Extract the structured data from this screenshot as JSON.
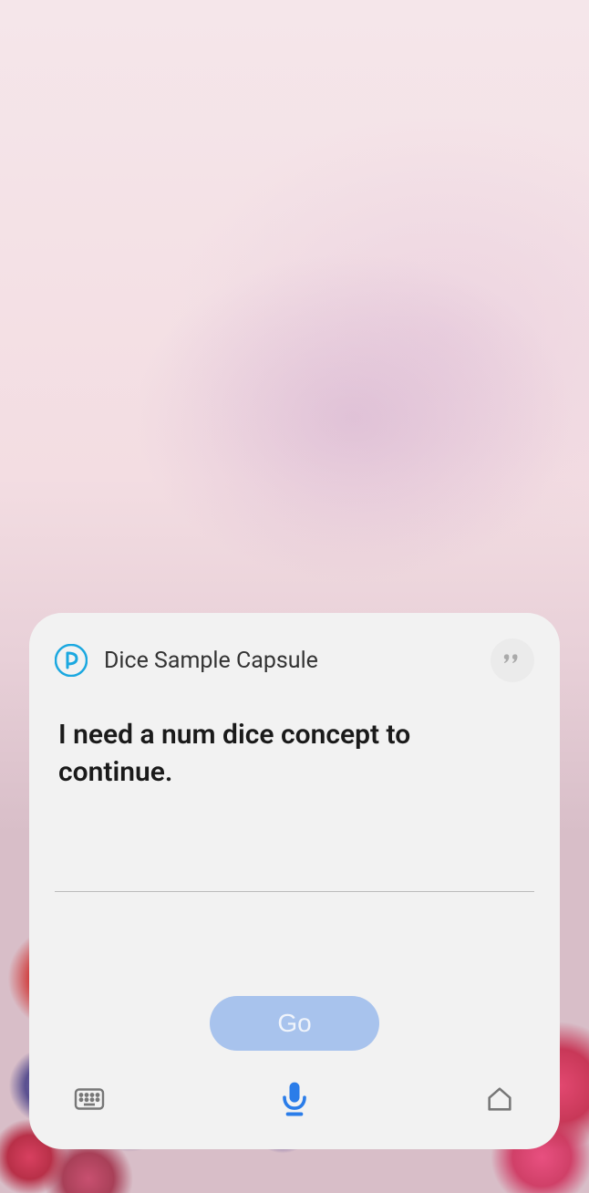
{
  "capsule": {
    "name": "Dice Sample Capsule",
    "message": "I need a num dice concept to continue."
  },
  "actions": {
    "go_label": "Go"
  },
  "icons": {
    "bixby": "bixby-icon",
    "quote": "quote-icon",
    "keyboard": "keyboard-icon",
    "microphone": "microphone-icon",
    "home": "home-icon"
  }
}
